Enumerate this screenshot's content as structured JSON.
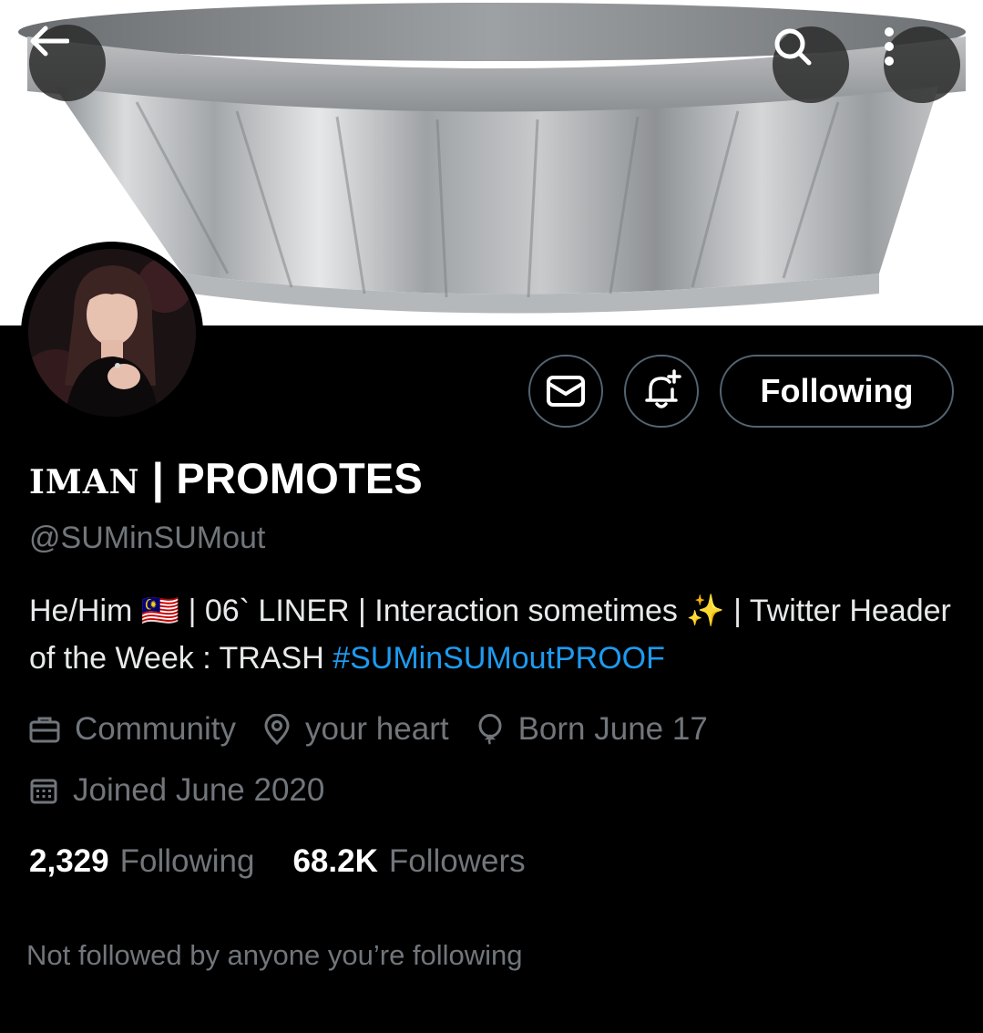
{
  "profile": {
    "display_name_prefix": "IMAN",
    "display_name_suffix": " | PROMOTES",
    "handle": "@SUMinSUMout",
    "bio_text": "He/Him 🇲🇾 | 06` LINER | Interaction sometimes ✨ | Twitter Header of the Week : TRASH ",
    "bio_hashtag": "#SUMinSUMoutPROOF",
    "category": "Community",
    "location": "your heart",
    "birthday": "Born June 17",
    "joined": "Joined June 2020"
  },
  "actions": {
    "follow_label": "Following"
  },
  "stats": {
    "following_count": "2,329",
    "following_label": "Following",
    "followers_count": "68.2K",
    "followers_label": "Followers"
  },
  "social_context": "Not followed by anyone you’re following",
  "icons": {
    "back": "arrow-left-icon",
    "search": "search-icon",
    "more": "more-vertical-icon",
    "message": "mail-icon",
    "notify": "bell-plus-icon",
    "category": "briefcase-icon",
    "location": "map-pin-icon",
    "birthday": "balloon-icon",
    "joined": "calendar-icon"
  },
  "colors": {
    "background": "#000000",
    "text": "#e7e9ea",
    "muted": "#71767b",
    "link": "#1d9bf0",
    "border": "#536471"
  }
}
